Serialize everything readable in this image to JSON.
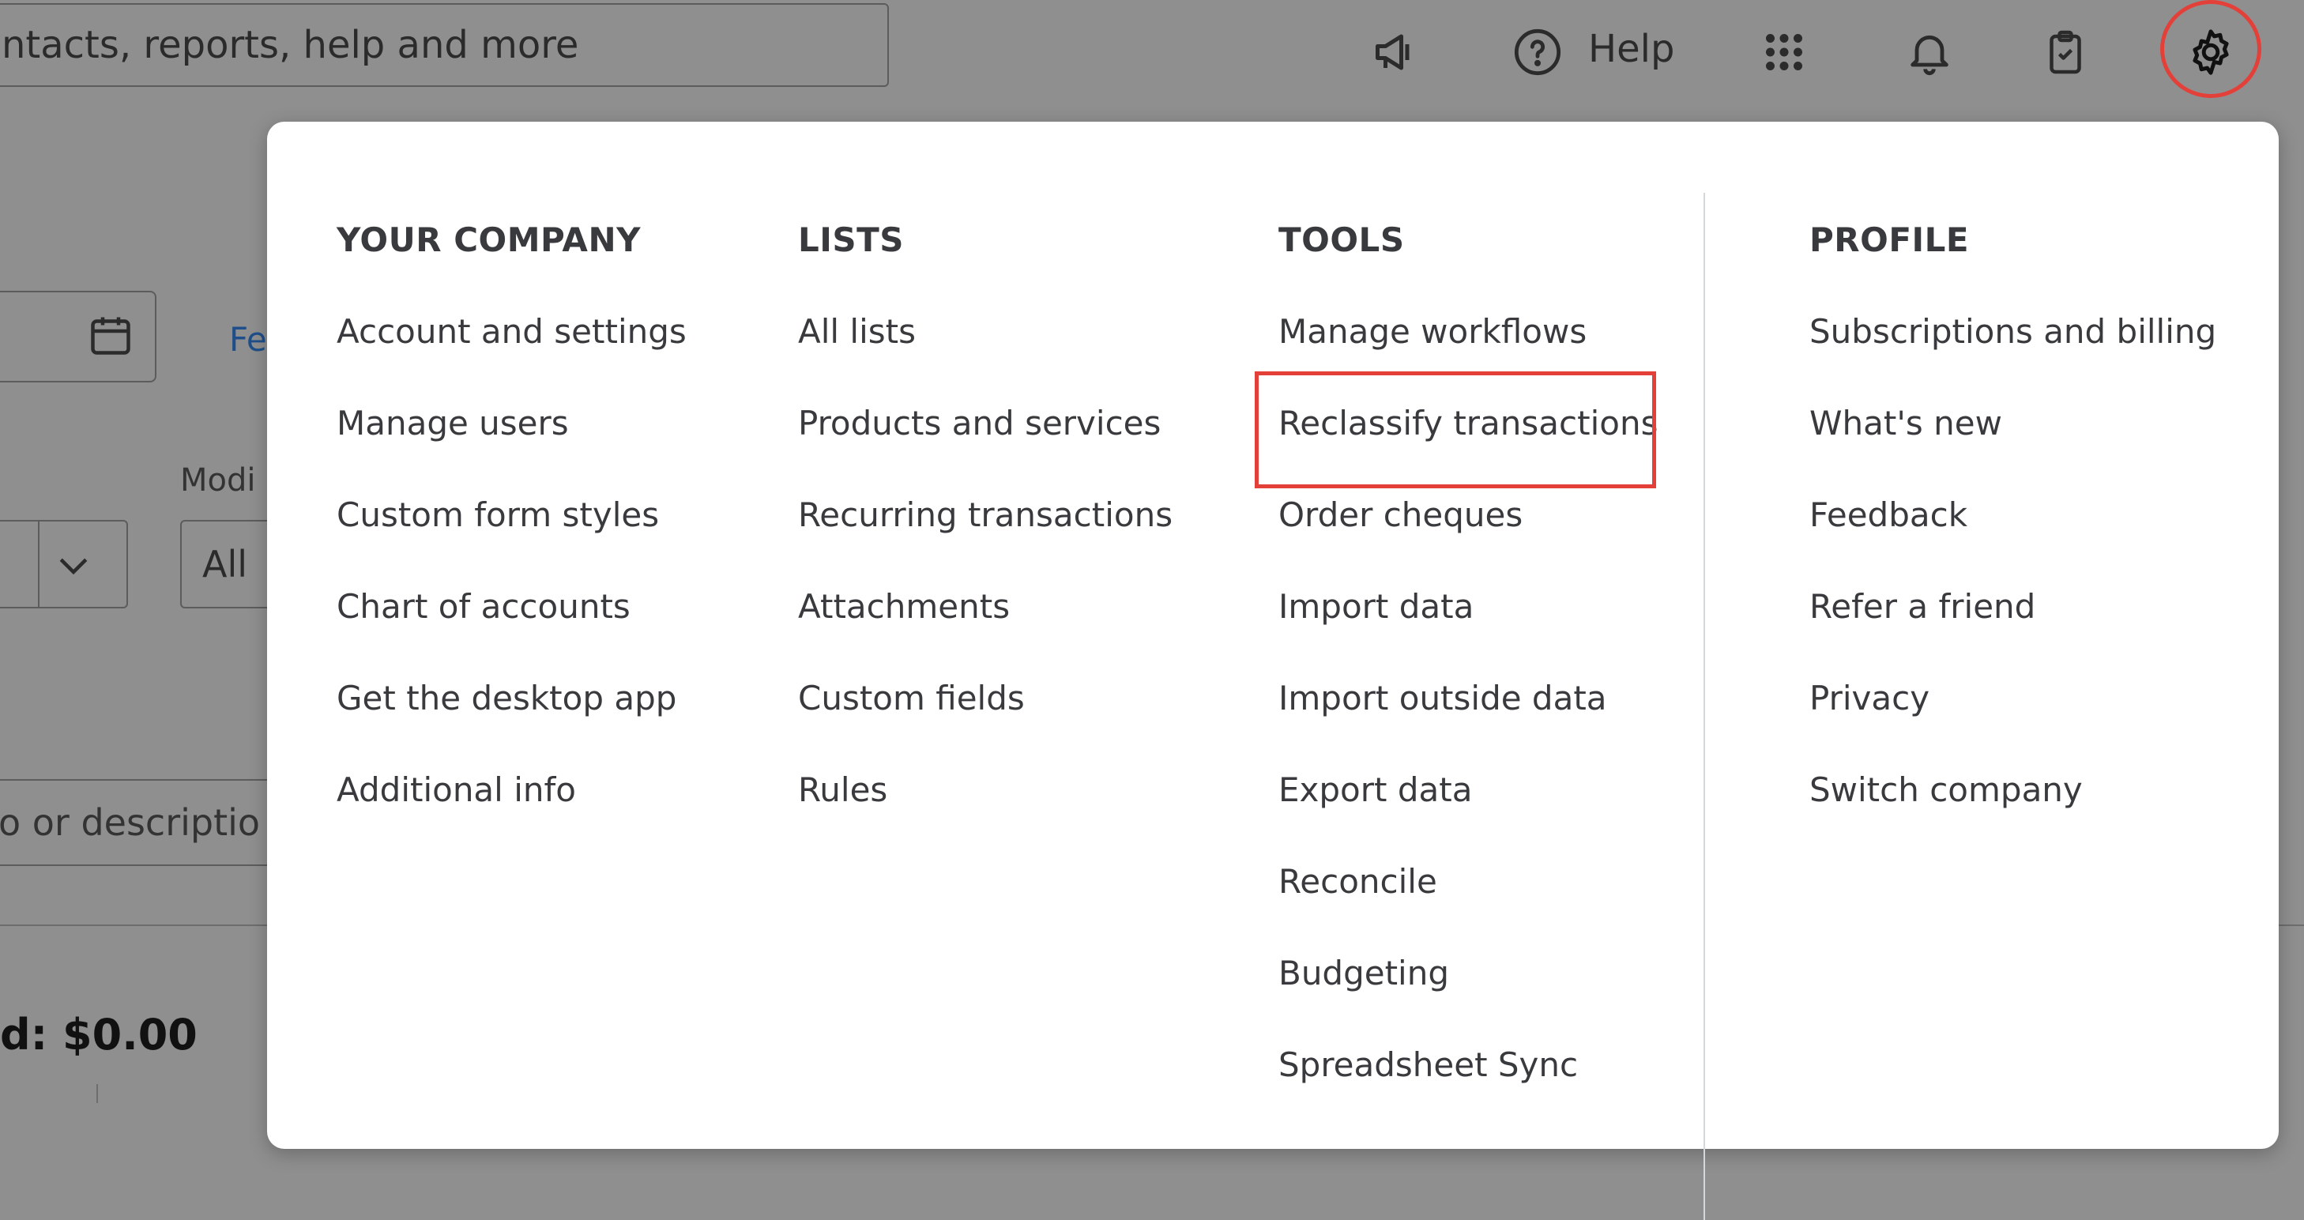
{
  "search": {
    "placeholder_visible": "ntacts, reports, help and more"
  },
  "topbar": {
    "help_label": "Help",
    "icons": [
      "megaphone-icon",
      "help-circle-icon",
      "apps-grid-icon",
      "bell-icon",
      "clipboard-check-icon",
      "gear-icon"
    ]
  },
  "background": {
    "link_partial": "Fe",
    "label_partial": "Modi",
    "dropdown_value": "All",
    "memo_placeholder_partial": "o or descriptio",
    "total_partial": "d: $0.00"
  },
  "menu": {
    "columns": [
      {
        "heading": "YOUR COMPANY",
        "items": [
          "Account and settings",
          "Manage users",
          "Custom form styles",
          "Chart of accounts",
          "Get the desktop app",
          "Additional info"
        ]
      },
      {
        "heading": "LISTS",
        "items": [
          "All lists",
          "Products and services",
          "Recurring transactions",
          "Attachments",
          "Custom fields",
          "Rules"
        ]
      },
      {
        "heading": "TOOLS",
        "items": [
          "Manage workflows",
          "Reclassify transactions",
          "Order cheques",
          "Import data",
          "Import outside data",
          "Export data",
          "Reconcile",
          "Budgeting",
          "Spreadsheet Sync"
        ]
      },
      {
        "heading": "PROFILE",
        "items": [
          "Subscriptions and billing",
          "What's new",
          "Feedback",
          "Refer a friend",
          "Privacy",
          "Switch company"
        ]
      }
    ]
  },
  "colors": {
    "highlight": "#e4403a",
    "overlay": "#8f8f8f",
    "panel": "#ffffff"
  }
}
